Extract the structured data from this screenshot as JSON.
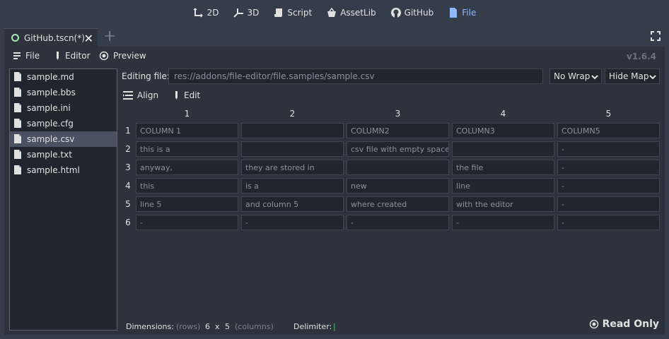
{
  "main_screen": [
    {
      "label": "2D",
      "icon": "2d-icon",
      "active": false
    },
    {
      "label": "3D",
      "icon": "3d-icon",
      "active": false
    },
    {
      "label": "Script",
      "icon": "script-icon",
      "active": false
    },
    {
      "label": "AssetLib",
      "icon": "assetlib-icon",
      "active": false
    },
    {
      "label": "GitHub",
      "icon": "github-icon",
      "active": false
    },
    {
      "label": "File",
      "icon": "file-icon",
      "active": true
    }
  ],
  "scene_tab": {
    "label": "GitHub.tscn(*)"
  },
  "toolbar": {
    "file_label": "File",
    "editor_label": "Editor",
    "preview_label": "Preview",
    "version": "v1.6.4"
  },
  "files": [
    {
      "name": "sample.md",
      "selected": false
    },
    {
      "name": "sample.bbs",
      "selected": false
    },
    {
      "name": "sample.ini",
      "selected": false
    },
    {
      "name": "sample.cfg",
      "selected": false
    },
    {
      "name": "sample.csv",
      "selected": true
    },
    {
      "name": "sample.txt",
      "selected": false
    },
    {
      "name": "sample.html",
      "selected": false
    }
  ],
  "editing": {
    "label": "Editing file:",
    "path": "res://addons/file-editor/file.samples/sample.csv",
    "wrap": "No Wrap",
    "map": "Hide Map"
  },
  "sub_toolbar": {
    "align_label": "Align",
    "edit_label": "Edit"
  },
  "table": {
    "columns": [
      "1",
      "2",
      "3",
      "4",
      "5"
    ],
    "rows": [
      {
        "num": "1",
        "cells": [
          "COLUMN 1",
          "",
          "COLUMN2",
          "COLUMN3",
          "COLUMN5"
        ]
      },
      {
        "num": "2",
        "cells": [
          "this is a",
          "",
          "csv file with empty space",
          "",
          "-"
        ]
      },
      {
        "num": "3",
        "cells": [
          "anyway,",
          "they are stored in",
          "",
          "the file",
          "-"
        ]
      },
      {
        "num": "4",
        "cells": [
          "this",
          "is a",
          "new",
          "line",
          "-"
        ]
      },
      {
        "num": "5",
        "cells": [
          "line 5",
          "and column 5",
          "where created",
          "with the editor",
          "-"
        ]
      },
      {
        "num": "6",
        "cells": [
          "-",
          "-",
          "-",
          "-",
          "-"
        ]
      }
    ]
  },
  "footer": {
    "dimensions_label": "Dimensions:",
    "rows_label": "(rows)",
    "rows": "6",
    "x": "x",
    "cols": "5",
    "cols_label": "(columns)",
    "delimiter_label": "Delimiter:",
    "delimiter_value": "|",
    "read_only": "Read Only"
  },
  "colors": {
    "accent": "#8eb8ff",
    "background": "#363d4a",
    "panel": "#2d323c",
    "field": "#21262e",
    "delimiter": "#4cc870"
  }
}
